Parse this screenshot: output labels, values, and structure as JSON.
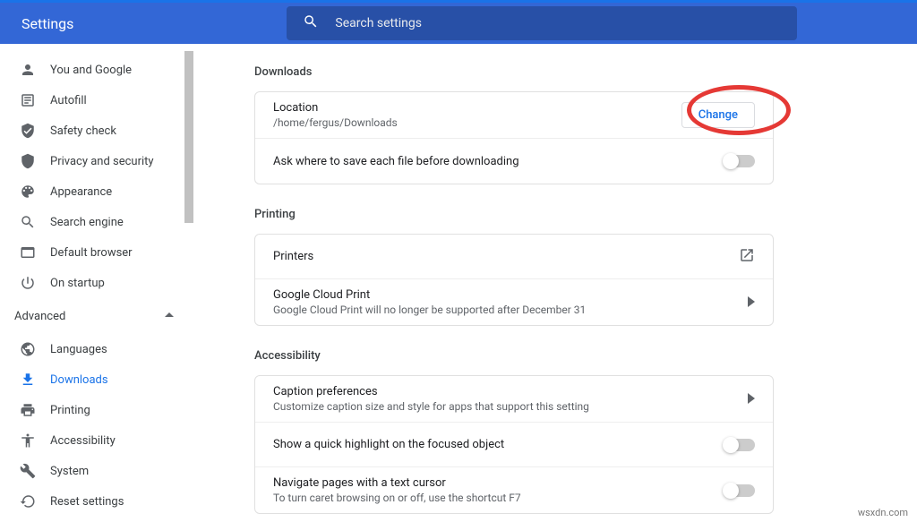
{
  "header": {
    "title": "Settings",
    "search_placeholder": "Search settings"
  },
  "sidebar": {
    "items": [
      {
        "label": "You and Google"
      },
      {
        "label": "Autofill"
      },
      {
        "label": "Safety check"
      },
      {
        "label": "Privacy and security"
      },
      {
        "label": "Appearance"
      },
      {
        "label": "Search engine"
      },
      {
        "label": "Default browser"
      },
      {
        "label": "On startup"
      }
    ],
    "section": "Advanced",
    "advanced_items": [
      {
        "label": "Languages"
      },
      {
        "label": "Downloads"
      },
      {
        "label": "Printing"
      },
      {
        "label": "Accessibility"
      },
      {
        "label": "System"
      },
      {
        "label": "Reset settings"
      }
    ]
  },
  "main": {
    "downloads": {
      "title": "Downloads",
      "location_label": "Location",
      "location_value": "/home/fergus/Downloads",
      "change_label": "Change",
      "ask_label": "Ask where to save each file before downloading"
    },
    "printing": {
      "title": "Printing",
      "printers_label": "Printers",
      "gcp_label": "Google Cloud Print",
      "gcp_sub": "Google Cloud Print will no longer be supported after December 31"
    },
    "accessibility": {
      "title": "Accessibility",
      "caption_label": "Caption preferences",
      "caption_sub": "Customize caption size and style for apps that support this setting",
      "highlight_label": "Show a quick highlight on the focused object",
      "caret_label": "Navigate pages with a text cursor",
      "caret_sub": "To turn caret browsing on or off, use the shortcut F7"
    }
  },
  "watermark": "wsxdn.com"
}
